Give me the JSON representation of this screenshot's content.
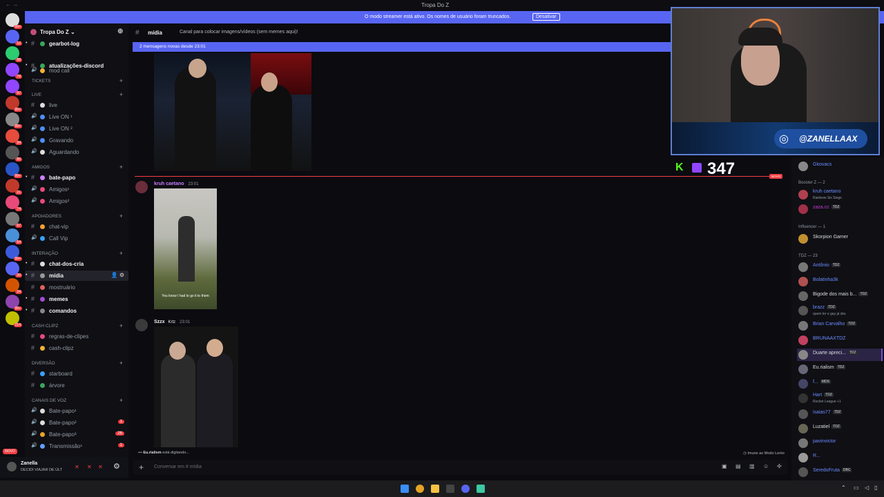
{
  "window": {
    "title": "Tropa Do Z",
    "nav": "← →"
  },
  "banner": {
    "text": "O modo streamer está ativo. Os nomes de usuário foram truncados.",
    "button": "Desativar"
  },
  "guild": {
    "name": "Tropa Do Z ⌄"
  },
  "channels": {
    "items": [
      {
        "name": "gearbot-log",
        "bright": true
      },
      {
        "name": "atualizações-discord",
        "bright": true
      },
      {
        "name": "mod call"
      },
      {
        "name": "live"
      },
      {
        "name": "Live ON ¹"
      },
      {
        "name": "Live ON ²"
      },
      {
        "name": "Gravando"
      },
      {
        "name": "Aguardando"
      },
      {
        "name": "bate-papo",
        "bright": true
      },
      {
        "name": "Amigos¹"
      },
      {
        "name": "Amigos²"
      },
      {
        "name": "chat-vip"
      },
      {
        "name": "Call Vip"
      },
      {
        "name": "chat-dos-cria",
        "bright": true
      },
      {
        "name": "mídia",
        "bright": true
      },
      {
        "name": "mostruário"
      },
      {
        "name": "memes",
        "bright": true
      },
      {
        "name": "comandos",
        "bright": true
      },
      {
        "name": "regras-de-clipes"
      },
      {
        "name": "cash-clipz"
      },
      {
        "name": "starboard"
      },
      {
        "name": "árvore"
      },
      {
        "name": "Bate-papo¹"
      },
      {
        "name": "Bate-papo²",
        "count": "1"
      },
      {
        "name": "Bate-papo³",
        "count": "26"
      },
      {
        "name": "Transmissão¹",
        "count": "1"
      }
    ],
    "categories": [
      {
        "name": "TICKETS"
      },
      {
        "name": "LIVE"
      },
      {
        "name": "AMIGOS"
      },
      {
        "name": "APOIADORES"
      },
      {
        "name": "INTERAÇÃO"
      },
      {
        "name": "CASH CLIPZ"
      },
      {
        "name": "DIVERSÃO"
      },
      {
        "name": "CANAIS DE VOZ"
      }
    ]
  },
  "user": {
    "name": "Zanella",
    "status": "DECIDI VIAJAR DE ÚLT"
  },
  "chat": {
    "channel": "mídia",
    "topic": "Canal para colocar imagens/vídeos (sem memes aqui)!",
    "new_messages": "2 mensagens novas desde 23:01",
    "divider_label": "NOVO",
    "messages": [
      {
        "author": "kruh caetano",
        "time": "23:01",
        "caption": "You know I had to go it to them"
      },
      {
        "author": "Szzx",
        "tag": "Krtz",
        "time": "23:01"
      }
    ],
    "typing_user": "Eu.rialism",
    "typing_text": " está digitando...",
    "slowmode": "Imune ao Modo Lento",
    "placeholder": "Conversar em # mídia"
  },
  "stream": {
    "viewers": "347",
    "handle": "@ZANELLAAX",
    "kick_letter": "K"
  },
  "members": {
    "sections": [
      {
        "label": "Booster Z — 2"
      },
      {
        "label": "Influencer — 1"
      },
      {
        "label": "TDZ — 23"
      }
    ],
    "items": [
      {
        "name": "Gkovacs",
        "color": "#6b8cff"
      },
      {
        "name": "kruh caetano",
        "color": "#6b8cff",
        "sub": "Rainbow Six Siege"
      },
      {
        "name": "zaza.cc",
        "color": "#c73ad8",
        "tag": "TDZ"
      },
      {
        "name": "Skorpion Gamer",
        "color": "#dbdee1"
      },
      {
        "name": "Antônio",
        "color": "#6b8cff",
        "tag": "TDZ"
      },
      {
        "name": "Bolatinha3k",
        "color": "#6b8cff"
      },
      {
        "name": "Bigode dos mais b...",
        "color": "#dbdee1",
        "tag": "TDZ"
      },
      {
        "name": "brazz",
        "color": "#6b8cff",
        "tag": "TDZ",
        "sub": "quem ler e gay já sbs"
      },
      {
        "name": "Brian Carvalho",
        "color": "#6b8cff",
        "tag": "TDZ"
      },
      {
        "name": "BRUNAAXTDZ",
        "color": "#6b8cff"
      },
      {
        "name": "Duarte apreci...",
        "color": "#dbdee1",
        "tag": "TDZ"
      },
      {
        "name": "Eu.rialism",
        "color": "#dbdee1",
        "tag": "TDZ"
      },
      {
        "name": "f...",
        "color": "#6b8cff",
        "tag": "MDS"
      },
      {
        "name": "Hart",
        "color": "#6b8cff",
        "tag": "TDZ",
        "sub": "Rocket League +1"
      },
      {
        "name": "isaias77",
        "color": "#6b8cff",
        "tag": "TDZ"
      },
      {
        "name": "Luzatiel",
        "color": "#dbdee1",
        "tag": "TDZ"
      },
      {
        "name": "pavinvictor",
        "color": "#6b8cff"
      },
      {
        "name": "R...",
        "color": "#6b8cff"
      },
      {
        "name": "SeredoFruta",
        "color": "#6b8cff",
        "tag": "DBC"
      }
    ]
  },
  "servers": {
    "badges": [
      "99+",
      "12",
      "88",
      "78",
      "97",
      "99+",
      "99+",
      "34",
      "85",
      "99+",
      "21",
      "74",
      "67",
      "64",
      "99+",
      "39",
      "24",
      "99+",
      "214"
    ],
    "novo": "NOVO"
  },
  "colors": {
    "accent": "#5865f2",
    "danger": "#f23f43",
    "kick": "#53fc18",
    "twitch": "#9146ff"
  }
}
